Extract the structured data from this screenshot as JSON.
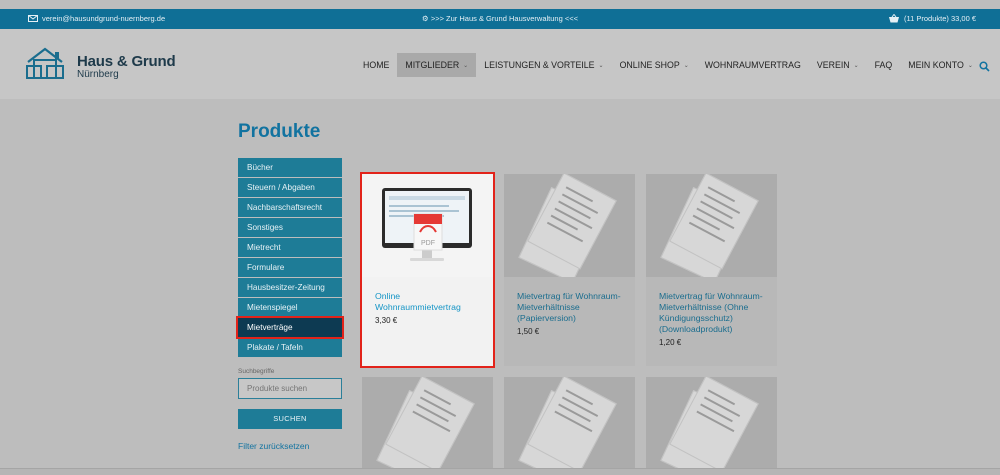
{
  "topbar": {
    "email": "verein@hausundgrund-nuernberg.de",
    "center_link": ">>> Zur Haus & Grund Hausverwaltung <<<",
    "cart": "(11 Produkte) 33,00 €"
  },
  "header": {
    "logo_title": "Haus & Grund",
    "logo_sub": "Nürnberg",
    "nav": [
      {
        "label": "HOME",
        "dropdown": false
      },
      {
        "label": "MITGLIEDER",
        "dropdown": true
      },
      {
        "label": "LEISTUNGEN & VORTEILE",
        "dropdown": true
      },
      {
        "label": "ONLINE SHOP",
        "dropdown": true
      },
      {
        "label": "WOHNRAUMVERTRAG",
        "dropdown": false
      },
      {
        "label": "VEREIN",
        "dropdown": true
      },
      {
        "label": "FAQ",
        "dropdown": false
      },
      {
        "label": "MEIN KONTO",
        "dropdown": true
      }
    ]
  },
  "page_title": "Produkte",
  "sidebar": {
    "categories": [
      "Bücher",
      "Steuern / Abgaben",
      "Nachbarschaftsrecht",
      "Sonstiges",
      "Mietrecht",
      "Formulare",
      "Hausbesitzer-Zeitung",
      "Mietenspiegel",
      "Mietverträge",
      "Plakate / Tafeln"
    ],
    "search_label": "Suchbegriffe",
    "search_placeholder": "Produkte suchen",
    "search_button": "SUCHEN",
    "reset_filter": "Filter zurücksetzen"
  },
  "products": [
    {
      "name": "Online Wohnraummietvertrag",
      "price": "3,30 €",
      "pdf_label": "PDF"
    },
    {
      "name": "Mietvertrag für Wohnraum-Mietverhältnisse (Papierversion)",
      "price": "1,50 €"
    },
    {
      "name": "Mietvertrag für Wohnraum-Mietverhältnisse (Ohne Kündigungsschutz) (Downloadprodukt)",
      "price": "1,20 €"
    }
  ],
  "colors": {
    "accent": "#1273a0",
    "highlight": "#e2231a",
    "sidebar": "#1e7c97",
    "selected": "#0d3a52"
  }
}
